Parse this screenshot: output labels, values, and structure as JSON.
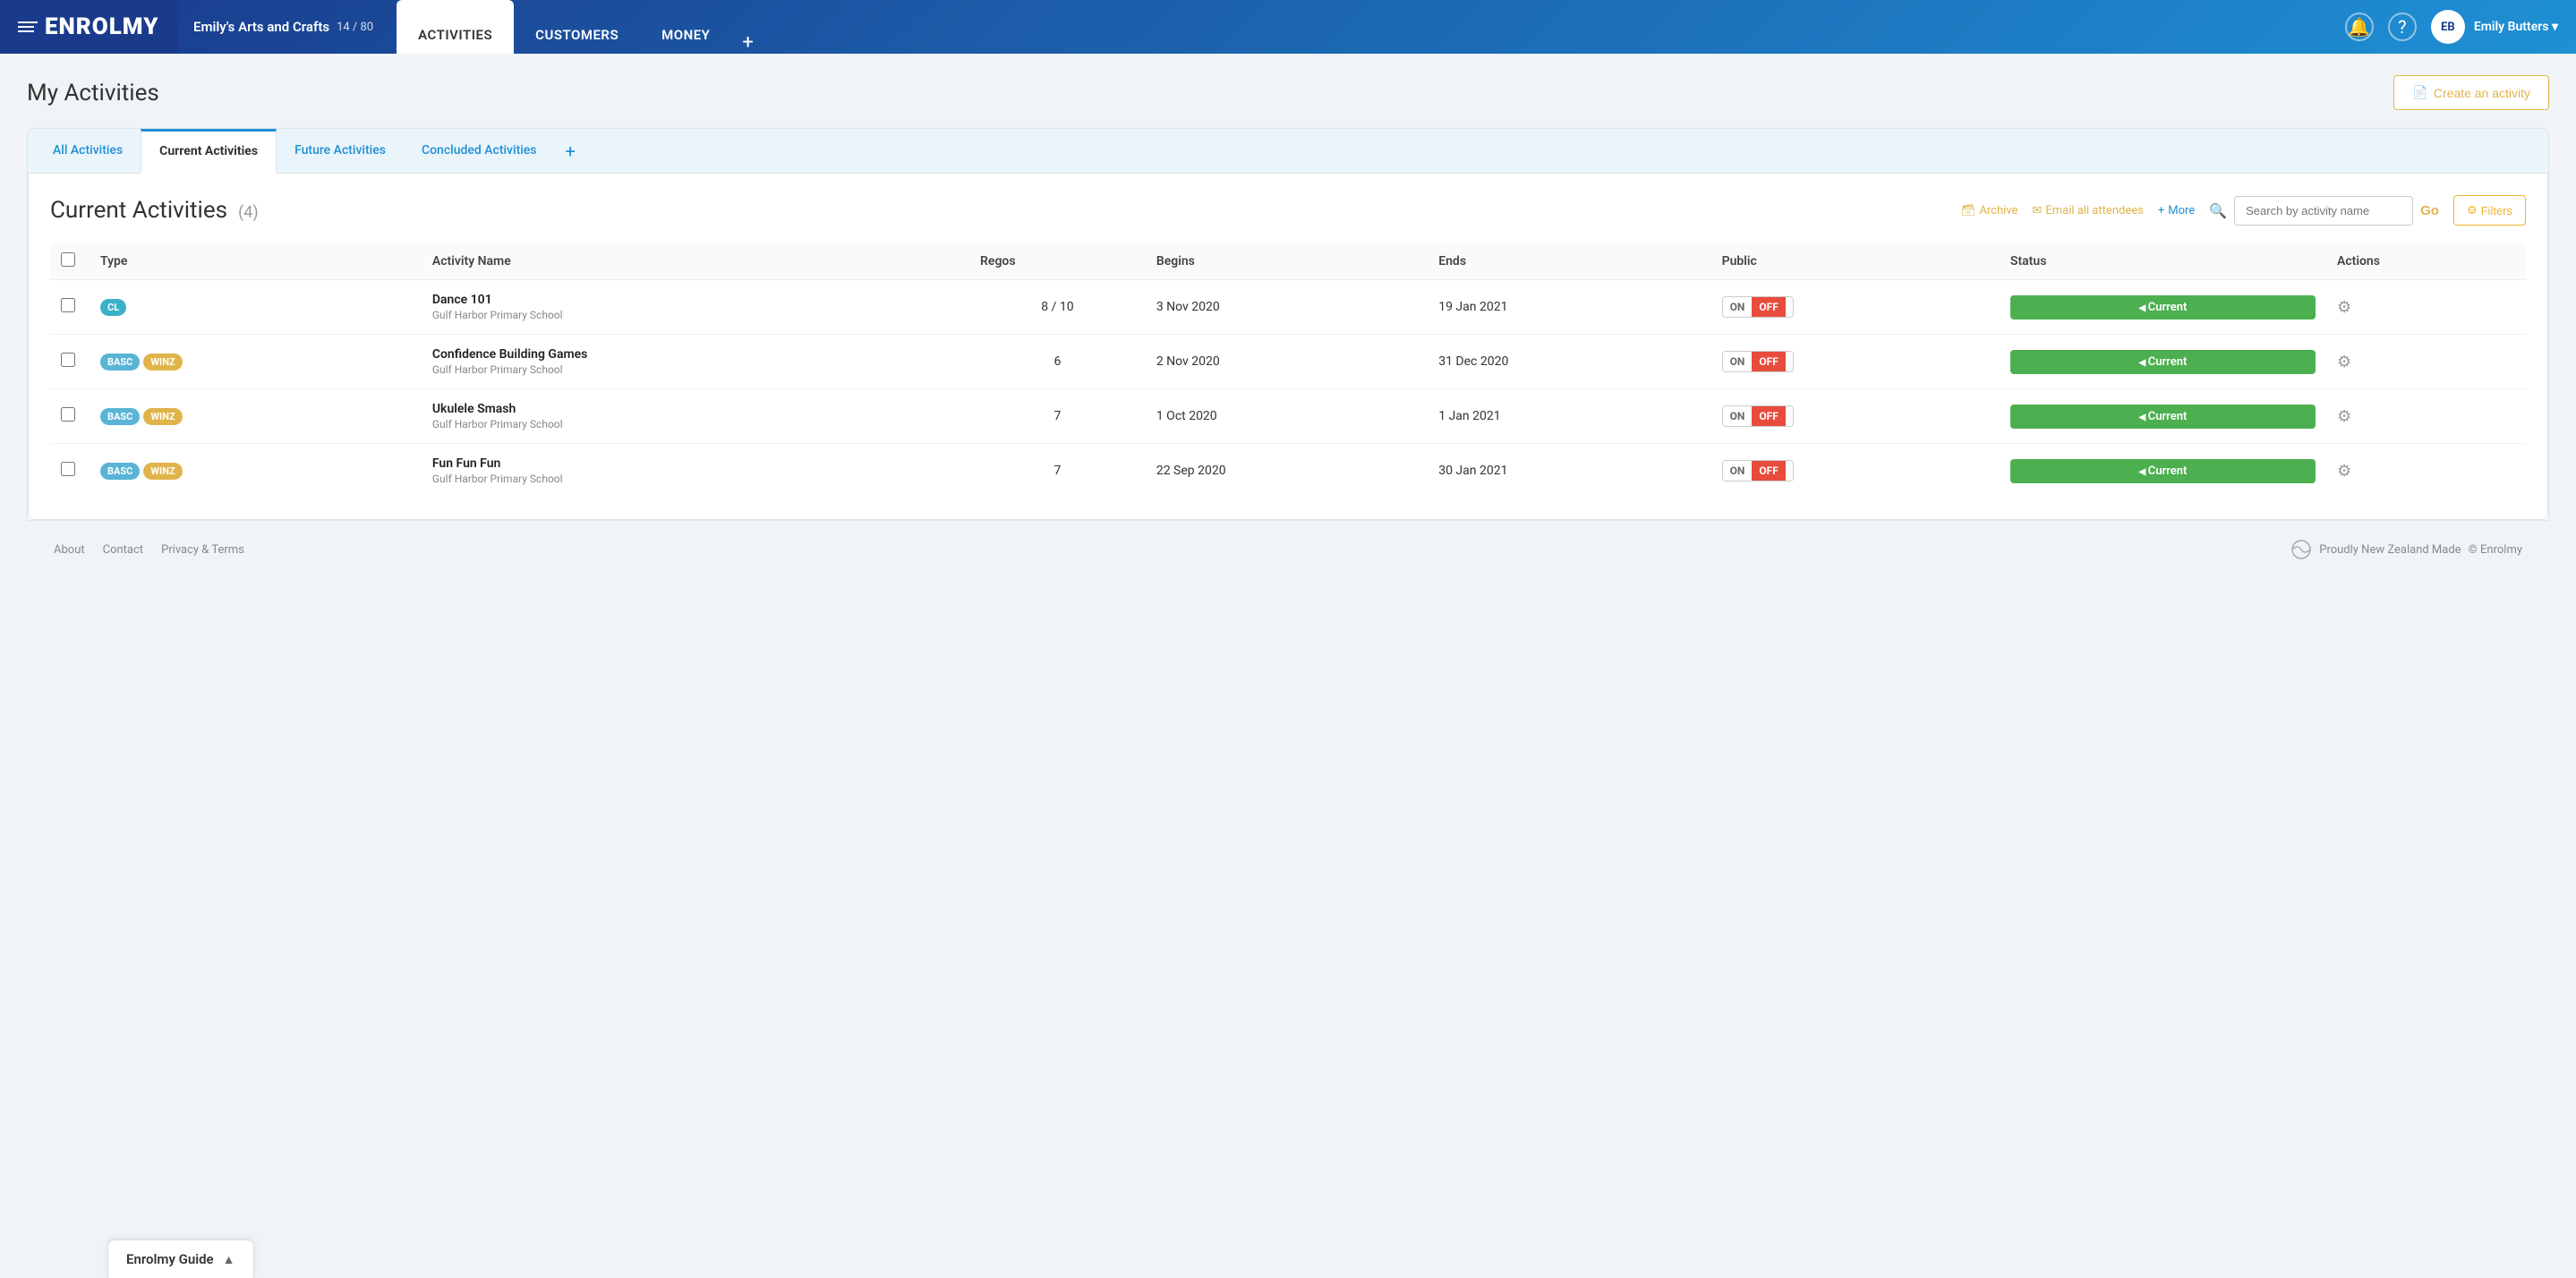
{
  "header": {
    "logo": "ENROLMY",
    "org_name": "Emily's Arts and Crafts",
    "org_count": "14 / 80",
    "nav_tabs": [
      {
        "label": "ACTIVITIES",
        "active": false
      },
      {
        "label": "CUSTOMERS",
        "active": false
      },
      {
        "label": "MONEY",
        "active": false
      }
    ],
    "user_initials": "EB",
    "user_name": "Emily Butters"
  },
  "page": {
    "title": "My Activities",
    "create_btn": "Create an activity"
  },
  "tabs": [
    {
      "label": "All Activities",
      "active": false
    },
    {
      "label": "Current Activities",
      "active": true
    },
    {
      "label": "Future Activities",
      "active": false
    },
    {
      "label": "Concluded Activities",
      "active": false
    }
  ],
  "section": {
    "title": "Current Activities",
    "count": "(4)",
    "archive_label": "Archive",
    "email_label": "Email all attendees",
    "more_label": "More",
    "search_placeholder": "Search by activity name",
    "go_label": "Go",
    "filters_label": "Filters",
    "table": {
      "columns": [
        "",
        "Type",
        "Activity Name",
        "Regos",
        "Begins",
        "Ends",
        "Public",
        "Status",
        "Actions"
      ],
      "rows": [
        {
          "badges": [
            "CL"
          ],
          "badge_types": [
            "cl"
          ],
          "name": "Dance 101",
          "location": "Gulf Harbor Primary School",
          "regos": "8 / 10",
          "begins": "3 Nov 2020",
          "ends": "19 Jan 2021",
          "public_on": "ON",
          "public_off": "OFF",
          "status": "Current"
        },
        {
          "badges": [
            "BASC",
            "WINZ"
          ],
          "badge_types": [
            "basc",
            "winz"
          ],
          "name": "Confidence Building Games",
          "location": "Gulf Harbor Primary School",
          "regos": "6",
          "begins": "2 Nov 2020",
          "ends": "31 Dec 2020",
          "public_on": "ON",
          "public_off": "OFF",
          "status": "Current"
        },
        {
          "badges": [
            "BASC",
            "WINZ"
          ],
          "badge_types": [
            "basc",
            "winz"
          ],
          "name": "Ukulele Smash",
          "location": "Gulf Harbor Primary School",
          "regos": "7",
          "begins": "1 Oct 2020",
          "ends": "1 Jan 2021",
          "public_on": "ON",
          "public_off": "OFF",
          "status": "Current"
        },
        {
          "badges": [
            "BASC",
            "WINZ"
          ],
          "badge_types": [
            "basc",
            "winz"
          ],
          "name": "Fun Fun Fun",
          "location": "Gulf Harbor Primary School",
          "regos": "7",
          "begins": "22 Sep 2020",
          "ends": "30 Jan 2021",
          "public_on": "ON",
          "public_off": "OFF",
          "status": "Current"
        }
      ]
    }
  },
  "footer": {
    "about": "About",
    "contact": "Contact",
    "privacy": "Privacy & Terms",
    "nz_made": "Proudly New Zealand Made",
    "copyright": "© Enrolmy"
  },
  "guide": {
    "label": "Enrolmy Guide"
  }
}
